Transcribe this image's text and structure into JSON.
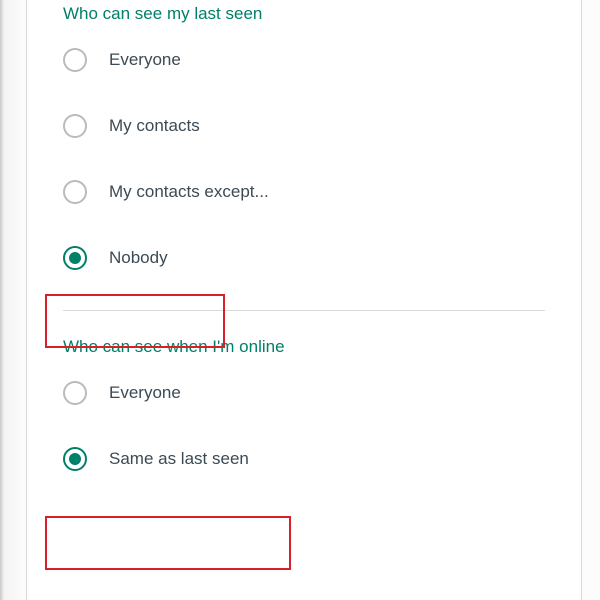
{
  "lastSeen": {
    "title": "Who can see my last seen",
    "options": [
      {
        "label": "Everyone",
        "selected": false
      },
      {
        "label": "My contacts",
        "selected": false
      },
      {
        "label": "My contacts except...",
        "selected": false
      },
      {
        "label": "Nobody",
        "selected": true
      }
    ]
  },
  "online": {
    "title": "Who can see when I'm online",
    "options": [
      {
        "label": "Everyone",
        "selected": false
      },
      {
        "label": "Same as last seen",
        "selected": true
      }
    ]
  }
}
